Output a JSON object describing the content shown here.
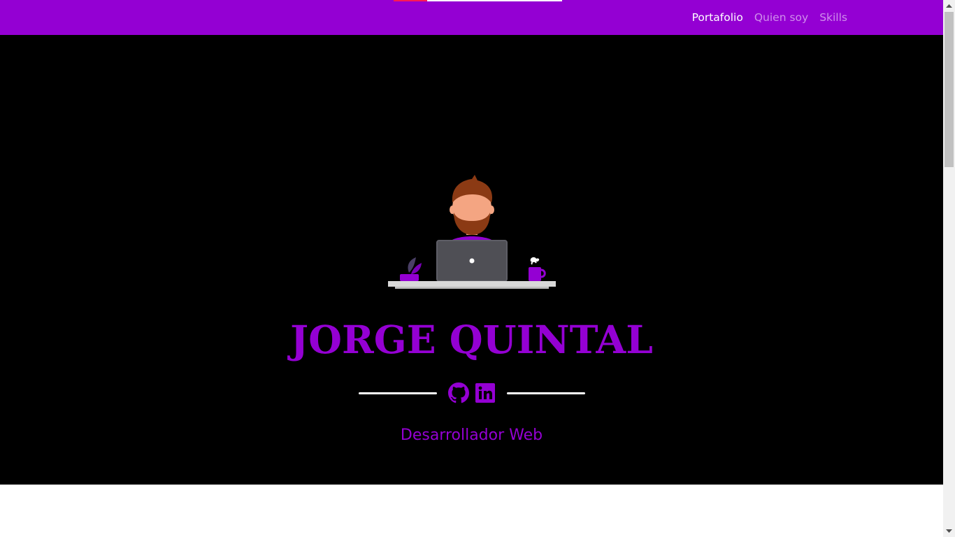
{
  "nav": {
    "links": [
      {
        "label": "Portafolio",
        "active": true
      },
      {
        "label": "Quien soy",
        "active": false
      },
      {
        "label": "Skills",
        "active": false
      }
    ],
    "scroll_progress": 0.2
  },
  "hero": {
    "title": "JORGE QUINTAL",
    "subtitle": "Desarrollador Web",
    "social_icons": [
      "github-icon",
      "linkedin-icon"
    ],
    "avatar_icon": "developer-at-desk-illustration"
  },
  "colors": {
    "brand": "#9400d3",
    "navbar": "#9400d3",
    "hero_background": "#000000",
    "progress_fill": "#ff1a55",
    "divider": "#ffffff"
  }
}
